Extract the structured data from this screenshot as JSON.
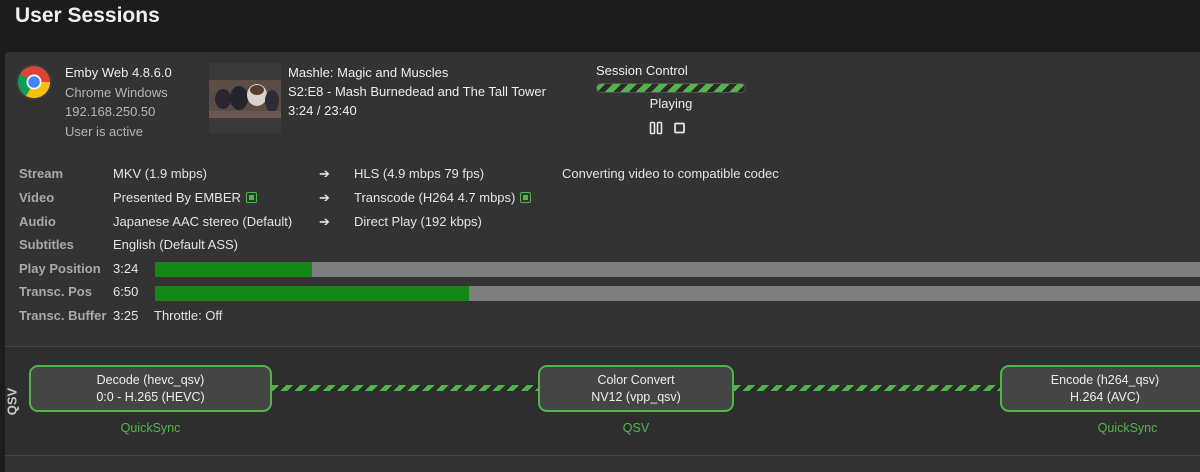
{
  "page": {
    "title": "User Sessions"
  },
  "client": {
    "icon": "chrome-icon",
    "app": "Emby Web 4.8.6.0",
    "device": "Chrome Windows",
    "ip": "192.168.250.50",
    "status": "User is active"
  },
  "media": {
    "series": "Mashle: Magic and Muscles",
    "episode": "S2:E8 - Mash Burnedead and The Tall Tower",
    "time": "3:24 / 23:40"
  },
  "session_control": {
    "label": "Session Control",
    "state": "Playing",
    "pause_icon": "pause-icon",
    "stop_icon": "stop-icon",
    "accent": "#52b54b"
  },
  "details": {
    "stream": {
      "label": "Stream",
      "source": "MKV (1.9 mbps)",
      "arrow": "➔",
      "target": "HLS (4.9 mbps 79 fps)",
      "note": "Converting video to compatible codec"
    },
    "video": {
      "label": "Video",
      "source": "Presented By EMBER",
      "arrow": "➔",
      "target": "Transcode (H264 4.7 mbps)"
    },
    "audio": {
      "label": "Audio",
      "source": "Japanese AAC stereo (Default)",
      "arrow": "➔",
      "target": "Direct Play (192 kbps)"
    },
    "subtitles": {
      "label": "Subtitles",
      "source": "English (Default ASS)"
    },
    "play_position": {
      "label": "Play Position",
      "value": "3:24",
      "progress": 0.15
    },
    "transc_pos": {
      "label": "Transc. Pos",
      "value": "6:50",
      "progress": 0.3
    },
    "transc_buffer": {
      "label": "Transc. Buffer",
      "value": "3:25",
      "throttle": "Throttle: Off"
    },
    "progress_color": "#148714"
  },
  "transcode": {
    "hw_label": "QSV",
    "nodes": [
      {
        "title": "Decode (hevc_qsv)",
        "detail": "0:0 - H.265 (HEVC)",
        "caption": "QuickSync"
      },
      {
        "title": "Color Convert",
        "detail": "NV12 (vpp_qsv)",
        "caption": "QSV"
      },
      {
        "title": "Encode (h264_qsv)",
        "detail": "H.264 (AVC)",
        "caption": "QuickSync"
      }
    ]
  }
}
